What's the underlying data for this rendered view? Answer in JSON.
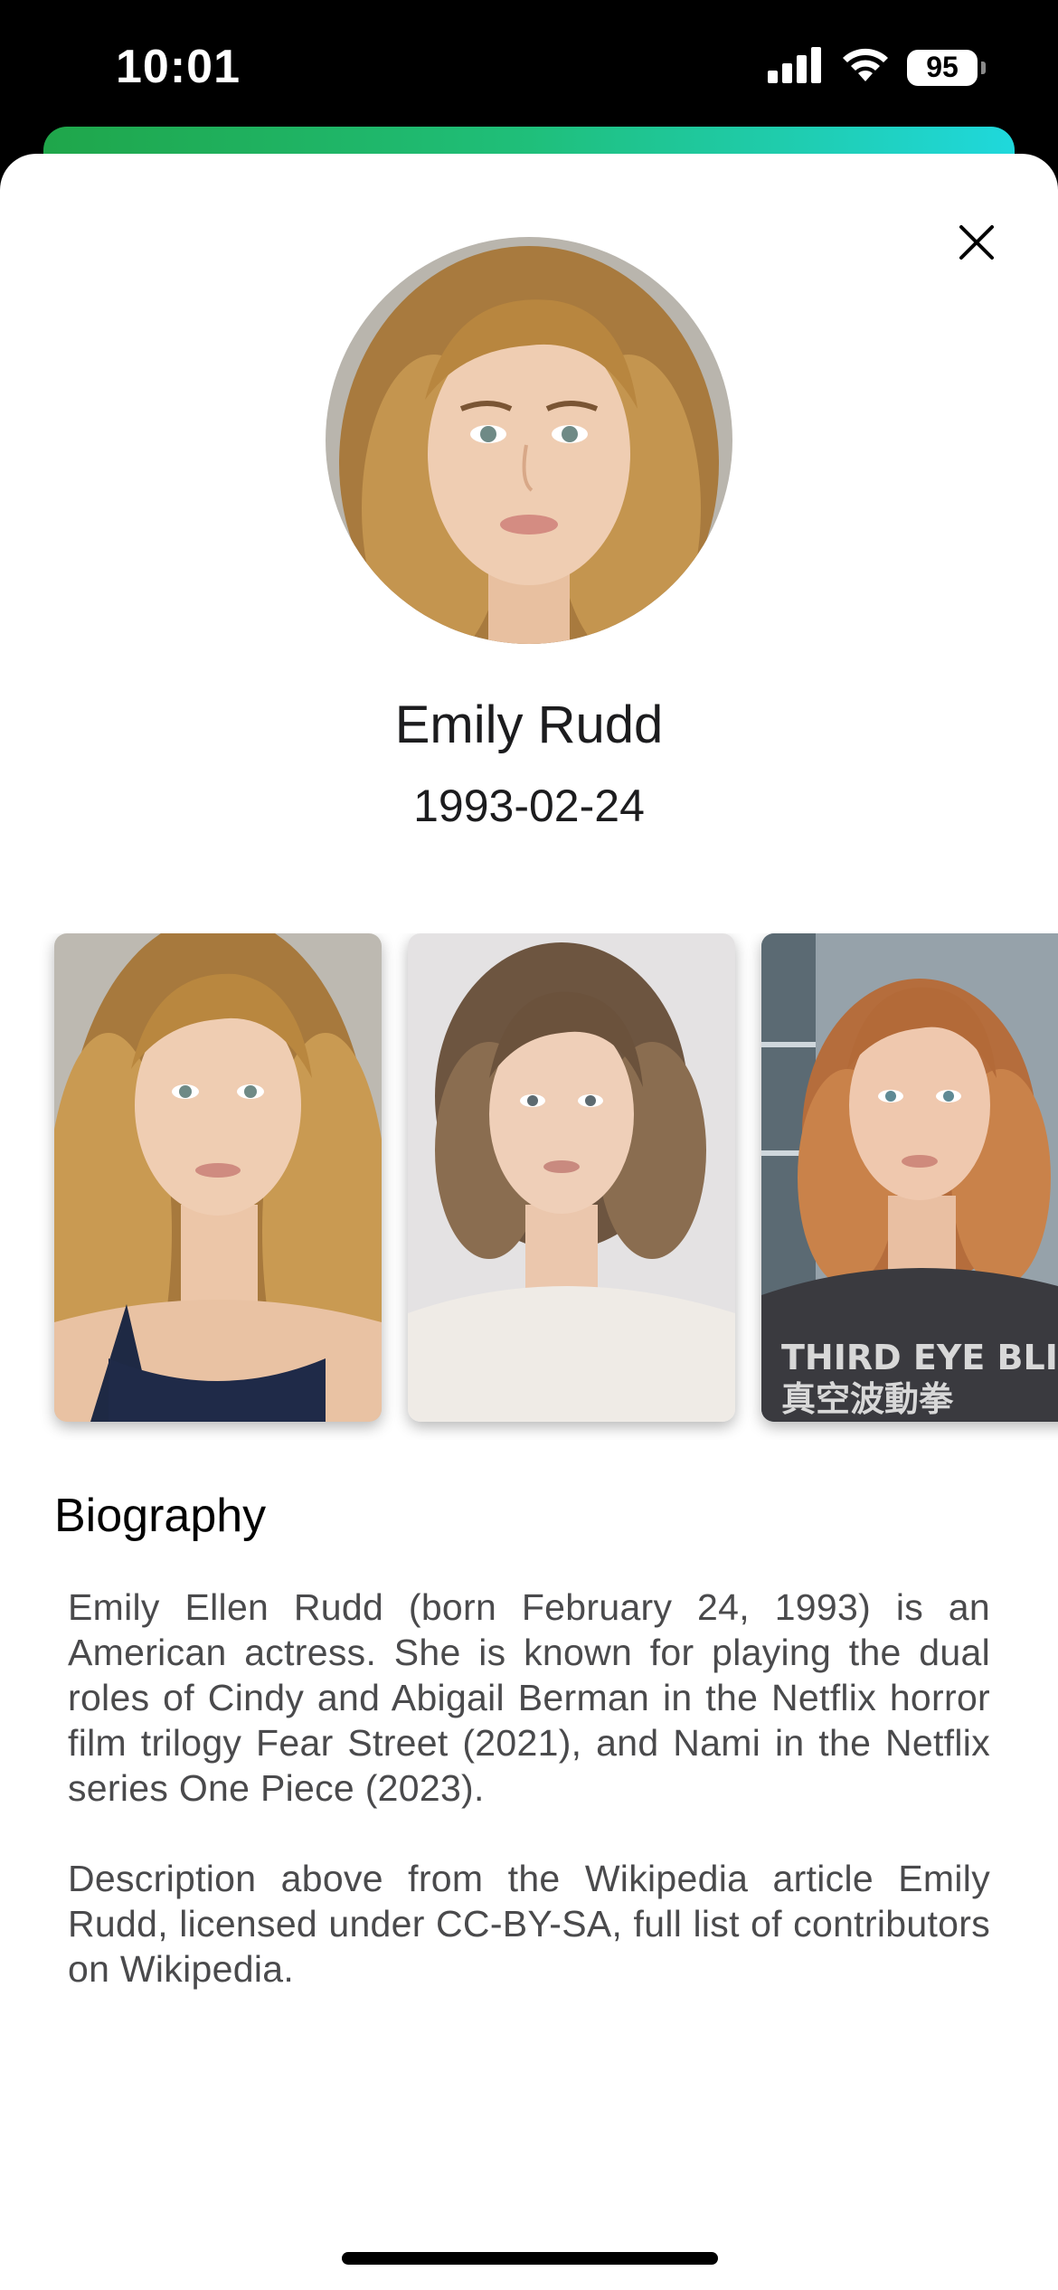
{
  "status_bar": {
    "time": "10:01",
    "battery_level": "95",
    "icons": [
      "cellular-signal-icon",
      "wifi-icon",
      "battery-icon"
    ]
  },
  "profile": {
    "name": "Emily Rudd",
    "birth_date": "1993-02-24"
  },
  "gallery": {
    "photos": [
      {
        "shirt_text_line1": "",
        "shirt_text_line2": ""
      },
      {
        "shirt_text_line1": "",
        "shirt_text_line2": ""
      },
      {
        "shirt_text_line1": "THIRD EYE BLIND",
        "shirt_text_line2": "真空波動拳"
      }
    ]
  },
  "biography": {
    "title": "Biography",
    "paragraphs": [
      "Emily Ellen Rudd (born February 24, 1993) is an American actress. She is known for playing the dual roles of Cindy and Abigail Berman in the Netflix horror film trilogy Fear Street (2021), and Nami in the Netflix series One Piece (2023).",
      "Description above from the Wikipedia article Emily Rudd, licensed under CC-BY-SA, full list of contributors on Wikipedia."
    ]
  },
  "colors": {
    "gradient_start": "#1fa64a",
    "gradient_end": "#1fd8dc",
    "text_primary": "#1c1c1e",
    "text_secondary": "#4a4a4c"
  }
}
